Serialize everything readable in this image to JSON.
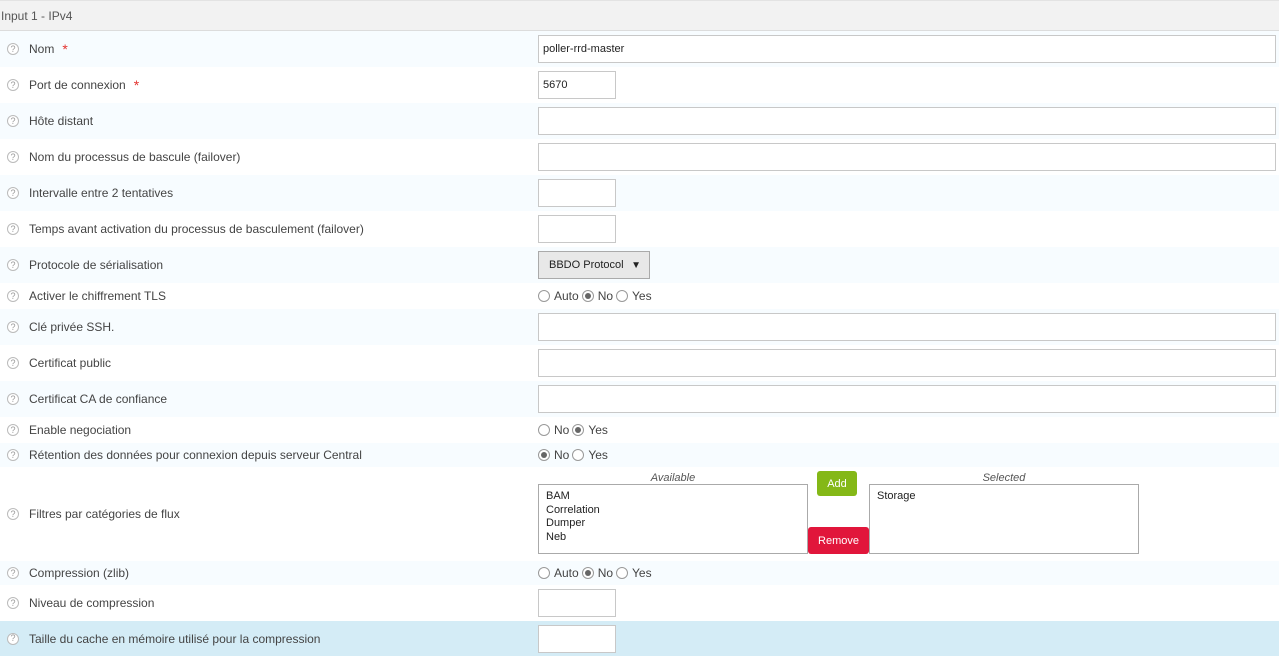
{
  "header": {
    "title": "Input 1 - IPv4"
  },
  "fields": {
    "nom": {
      "label": "Nom",
      "value": "poller-rrd-master"
    },
    "port": {
      "label": "Port de connexion",
      "value": "5670"
    },
    "hote": {
      "label": "Hôte distant",
      "value": ""
    },
    "failover": {
      "label": "Nom du processus de bascule (failover)",
      "value": ""
    },
    "retry": {
      "label": "Intervalle entre 2 tentatives",
      "value": ""
    },
    "buffering": {
      "label": "Temps avant activation du processus de basculement (failover)",
      "value": ""
    },
    "protocol": {
      "label": "Protocole de sérialisation",
      "value": "BBDO Protocol"
    },
    "tls": {
      "label": "Activer le chiffrement TLS",
      "options": [
        "Auto",
        "No",
        "Yes"
      ],
      "selected": "No"
    },
    "ssh_key": {
      "label": "Clé privée SSH.",
      "value": ""
    },
    "cert_public": {
      "label": "Certificat public",
      "value": ""
    },
    "cert_ca": {
      "label": "Certificat CA de confiance",
      "value": ""
    },
    "negotiation": {
      "label": "Enable negociation",
      "options": [
        "No",
        "Yes"
      ],
      "selected": "Yes"
    },
    "retention": {
      "label": "Rétention des données pour connexion depuis serveur Central",
      "options": [
        "No",
        "Yes"
      ],
      "selected": "No"
    },
    "filters": {
      "label": "Filtres par catégories de flux",
      "available_caption": "Available",
      "selected_caption": "Selected",
      "available": [
        "BAM",
        "Correlation",
        "Dumper",
        "Neb"
      ],
      "selected": [
        "Storage"
      ],
      "add_label": "Add",
      "remove_label": "Remove"
    },
    "compression": {
      "label": "Compression (zlib)",
      "options": [
        "Auto",
        "No",
        "Yes"
      ],
      "selected": "No"
    },
    "compression_level": {
      "label": "Niveau de compression",
      "value": ""
    },
    "compression_buffer": {
      "label": "Taille du cache en mémoire utilisé pour la compression",
      "value": ""
    }
  },
  "required_marker": "*",
  "help_icon": "?",
  "colors": {
    "add": "#84b817",
    "remove": "#e1163b",
    "required": "#e3332f",
    "row_highlight": "#d4ecf6"
  }
}
